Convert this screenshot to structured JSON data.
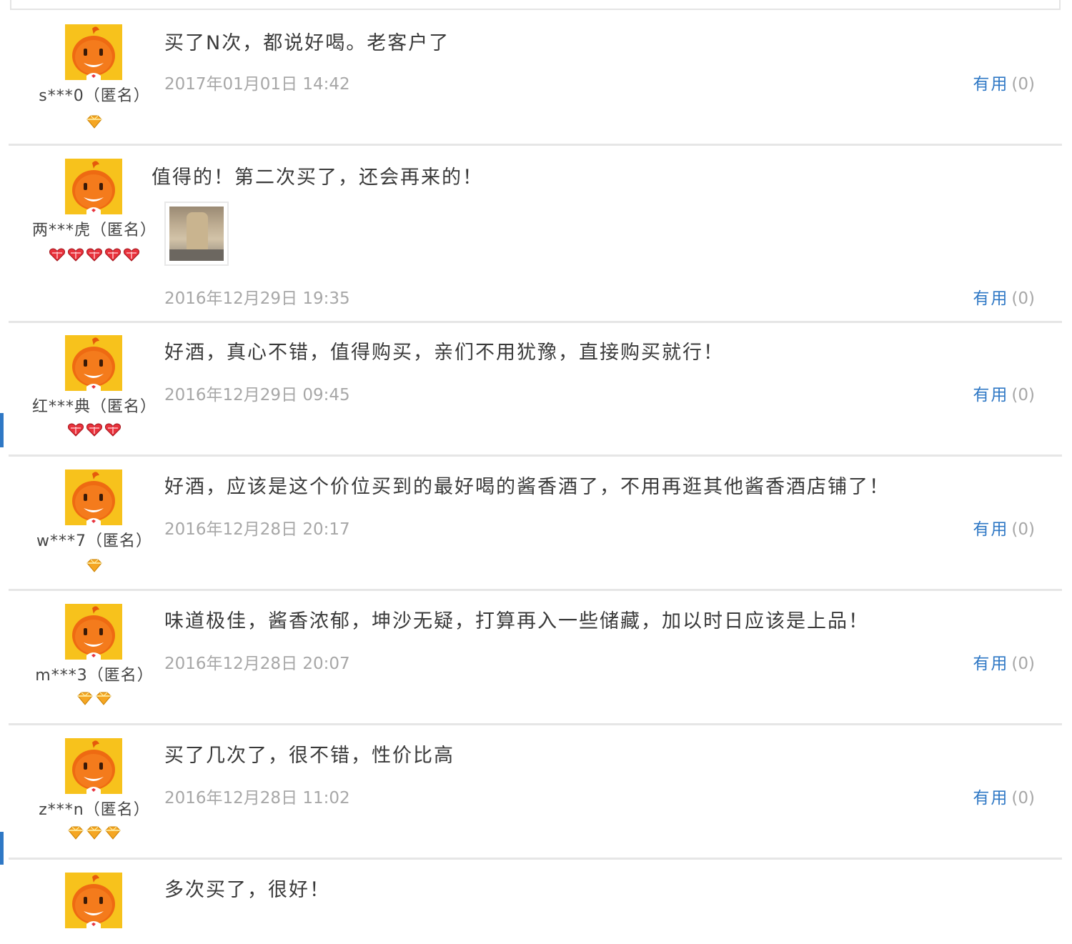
{
  "reviews": [
    {
      "user": "s***0（匿名）",
      "content": "买了N次，都说好喝。老客户了",
      "date": "2017年01月01日 14:42",
      "useful_label": "有用",
      "useful_count": "(0)",
      "level": {
        "type": "diamond",
        "count": 1,
        "color": "#f5a623"
      }
    },
    {
      "user": "两***虎（匿名）",
      "content": "值得的！第二次买了，还会再来的！",
      "date": "2016年12月29日 19:35",
      "useful_label": "有用",
      "useful_count": "(0)",
      "has_image": true,
      "level": {
        "type": "heart",
        "count": 5,
        "color": "#e8323c"
      }
    },
    {
      "user": "红***典（匿名）",
      "content": "好酒，真心不错，值得购买，亲们不用犹豫，直接购买就行！",
      "date": "2016年12月29日 09:45",
      "useful_label": "有用",
      "useful_count": "(0)",
      "level": {
        "type": "heart",
        "count": 3,
        "color": "#e8323c"
      }
    },
    {
      "user": "w***7（匿名）",
      "content": "好酒，应该是这个价位买到的最好喝的酱香酒了，不用再逛其他酱香酒店铺了！",
      "date": "2016年12月28日 20:17",
      "useful_label": "有用",
      "useful_count": "(0)",
      "level": {
        "type": "diamond",
        "count": 1,
        "color": "#f5a623"
      }
    },
    {
      "user": "m***3（匿名）",
      "content": "味道极佳，酱香浓郁，坤沙无疑，打算再入一些储藏，加以时日应该是上品！",
      "date": "2016年12月28日 20:07",
      "useful_label": "有用",
      "useful_count": "(0)",
      "level": {
        "type": "diamond",
        "count": 2,
        "color": "#f5a623"
      }
    },
    {
      "user": "z***n（匿名）",
      "content": "买了几次了，很不错，性价比高",
      "date": "2016年12月28日 11:02",
      "useful_label": "有用",
      "useful_count": "(0)",
      "level": {
        "type": "diamond",
        "count": 3,
        "color": "#f5a623"
      }
    },
    {
      "user": "",
      "content": "多次买了，很好！"
    }
  ]
}
